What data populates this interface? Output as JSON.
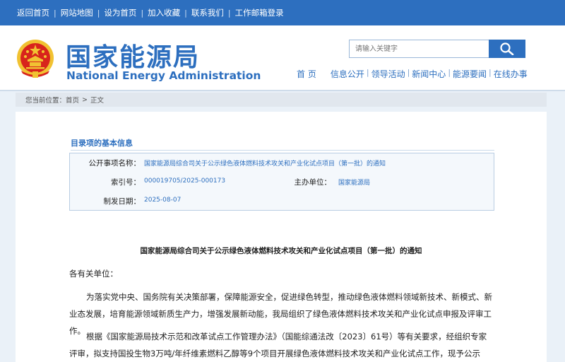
{
  "topbar": {
    "links": [
      "返回首页",
      "网站地图",
      "设为首页",
      "加入收藏",
      "联系我们",
      "工作邮箱登录"
    ]
  },
  "header": {
    "title_cn": "国家能源局",
    "title_en": "National Energy Administration",
    "search_placeholder": "请输入关键字",
    "nav": [
      "首 页",
      "信息公开",
      "领导活动",
      "新闻中心",
      "能源要闻",
      "在线办事"
    ]
  },
  "breadcrumb": {
    "prefix": "您当前位置：",
    "items": [
      "首页",
      "正文"
    ]
  },
  "info": {
    "heading": "目录项的基本信息",
    "subject_label": "公开事项名称：",
    "subject_value": "国家能源局综合司关于公示绿色液体燃料技术攻关和产业化试点项目（第一批）的通知",
    "index_label": "索引号：",
    "index_value": "000019705/2025-000173",
    "org_label": "主办单位：",
    "org_value": "国家能源局",
    "date_label": "制发日期：",
    "date_value": "2025-08-07"
  },
  "article": {
    "title": "国家能源局综合司关于公示绿色液体燃料技术攻关和产业化试点项目（第一批）的通知",
    "salutation": "各有关单位：",
    "paragraph1": "为落实党中央、国务院有关决策部署，保障能源安全，促进绿色转型，推动绿色液体燃料领域新技术、新模式、新业态发展，培育能源领域新质生产力，增强发展新动能，我局组织了绿色液体燃料技术攻关和产业化试点申报及评审工作。",
    "paragraph2": "根据《国家能源局技术示范和改革试点工作管理办法》（国能综通法改〔2023〕61号）等有关要求，经组织专家评审，拟支持国投生物3万吨/年纤维素燃料乙醇等9个项目开展绿色液体燃料技术攻关和产业化试点工作，现予公示（详见附件）。"
  },
  "colors": {
    "brand_blue": "#2d6fbf",
    "emblem_red": "#d8241c",
    "emblem_gold": "#f1c232"
  }
}
